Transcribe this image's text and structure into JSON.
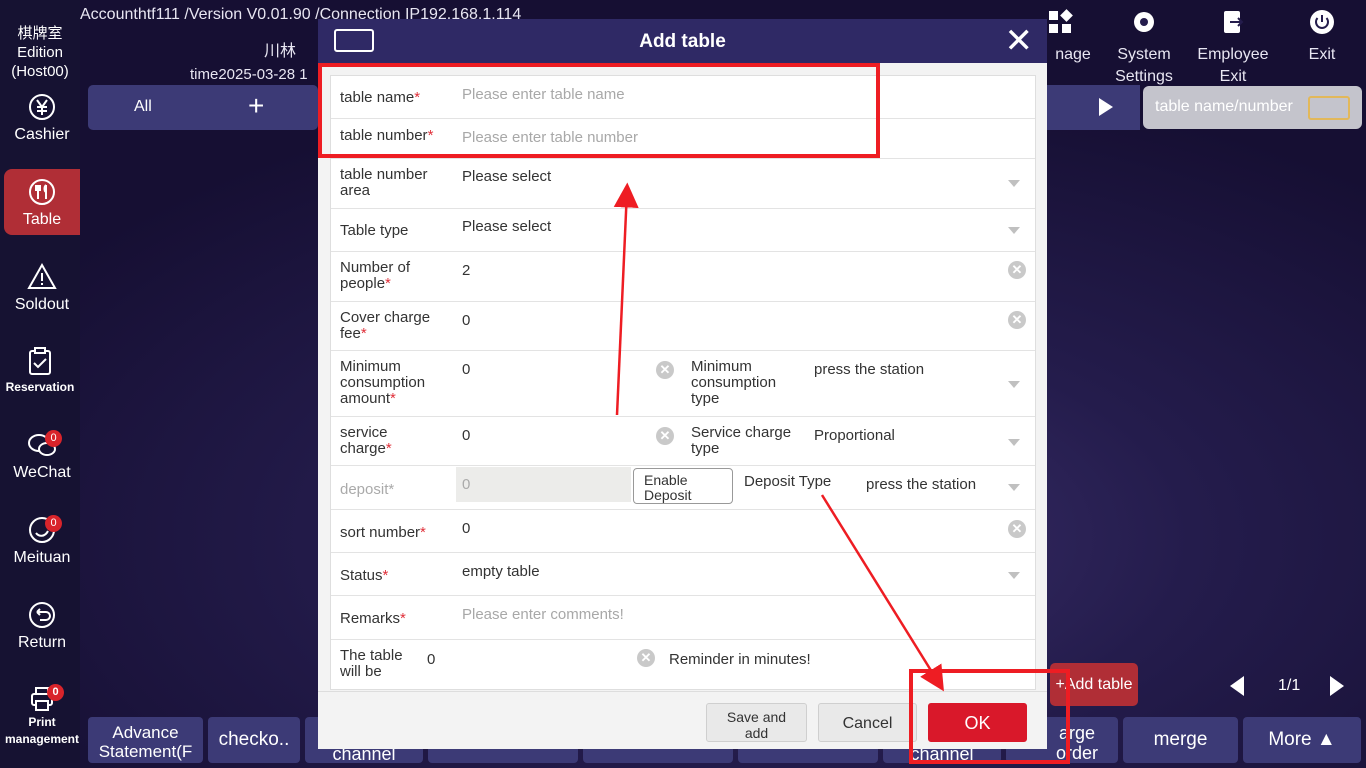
{
  "sidebar": {
    "brand": [
      "棋牌室",
      "Edition",
      "(Host00)"
    ],
    "items": [
      {
        "label": "Cashier",
        "icon": "yen-icon"
      },
      {
        "label": "Table",
        "icon": "fork-knife-icon"
      },
      {
        "label": "Soldout",
        "icon": "warning-icon"
      },
      {
        "label": "Reservation",
        "icon": "clipboard-check-icon"
      },
      {
        "label": "WeChat",
        "icon": "wechat-icon",
        "badge": "0"
      },
      {
        "label": "Meituan",
        "icon": "meituan-icon",
        "badge": "0"
      },
      {
        "label": "Return",
        "icon": "return-icon"
      },
      {
        "label": "Print management",
        "icon": "printer-icon",
        "badge": "0"
      }
    ]
  },
  "header": {
    "account": "Accounthtf111 /Version V0.01.90 /Connection IP192.168.1.114",
    "store": "川林",
    "time": "time2025-03-28 1",
    "buttons": [
      {
        "label": "nage",
        "icon": "grid-icon"
      },
      {
        "label": "System Settings",
        "icon": "gear-icon"
      },
      {
        "label": "Employee Exit",
        "icon": "logout-icon"
      },
      {
        "label": "Exit",
        "icon": "power-icon"
      }
    ]
  },
  "categories": {
    "all": "All",
    "add": "+"
  },
  "search": {
    "placeholder": "table name/number"
  },
  "add_table_button": "+Add table",
  "pager": {
    "page": "1/1"
  },
  "bottom_buttons": [
    "Advance Statement(F",
    "checko..",
    "channel",
    "channel",
    "arge order",
    "merge",
    "More ▲"
  ],
  "modal": {
    "title": "Add table",
    "fields": {
      "table_name": {
        "label": "table name",
        "placeholder": "Please enter table name"
      },
      "table_number": {
        "label": "table number",
        "placeholder": "Please enter table number"
      },
      "area": {
        "label": "table number area",
        "value": "Please select"
      },
      "table_type": {
        "label": "Table type",
        "value": "Please select"
      },
      "people": {
        "label": "Number of people",
        "value": "2"
      },
      "cover_fee": {
        "label": "Cover charge fee",
        "value": "0"
      },
      "min_consumption": {
        "label": "Minimum consumption amount",
        "value": "0"
      },
      "min_consumption_type": {
        "label": "Minimum consumption type",
        "value": "press the station"
      },
      "service_charge": {
        "label": "service charge",
        "value": "0"
      },
      "service_charge_type": {
        "label": "Service charge type",
        "value": "Proportional"
      },
      "deposit": {
        "label": "deposit*",
        "value": "0",
        "toggle": "Enable Deposit"
      },
      "deposit_type": {
        "label": "Deposit Type",
        "value": "press the station"
      },
      "sort_number": {
        "label": "sort number",
        "value": "0"
      },
      "status": {
        "label": "Status",
        "value": "empty table"
      },
      "remarks": {
        "label": "Remarks",
        "placeholder": "Please enter comments!"
      },
      "table_will_be": {
        "label": "The table will be",
        "value": "0",
        "suffix": "Reminder in minutes!"
      }
    },
    "buttons": {
      "save_add": "Save and add",
      "cancel": "Cancel",
      "ok": "OK"
    }
  },
  "colors": {
    "accent_red": "#d9182a",
    "sidebar_active": "#b02e36",
    "modal_header": "#2f2965",
    "annotation": "#ee1d23"
  }
}
